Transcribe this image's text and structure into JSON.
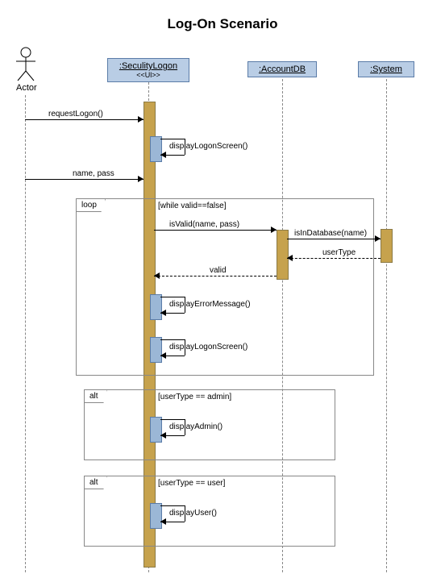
{
  "title": "Log-On Scenario",
  "actor": {
    "label": "Actor"
  },
  "lifelines": {
    "security": {
      "label": ":SeculityLogon",
      "stereotype": "<<Ul>>"
    },
    "accountdb": {
      "label": ":AccountDB"
    },
    "system": {
      "label": ":System"
    }
  },
  "messages": {
    "requestLogon": "requestLogon()",
    "displayLogonScreen1": "displayLogonScreen()",
    "namePass": "name, pass",
    "isValid": "isValid(name, pass)",
    "isInDatabase": "isInDatabase(name)",
    "userType": "userType",
    "valid": "valid",
    "displayErrorMessage": "displayErrorMessage()",
    "displayLogonScreen2": "displayLogonScreen()",
    "displayAdmin": "displayAdmin()",
    "displayUser": "displayUser()"
  },
  "frames": {
    "loop": {
      "operator": "loop",
      "guard": "[while valid==false]"
    },
    "alt1": {
      "operator": "alt",
      "guard": "[userType == admin]"
    },
    "alt2": {
      "operator": "alt",
      "guard": "[userType == user]"
    }
  },
  "chart_data": {
    "type": "uml-sequence-diagram",
    "title": "Log-On Scenario",
    "participants": [
      {
        "id": "actor",
        "name": "Actor",
        "kind": "actor"
      },
      {
        "id": "security",
        "name": ":SeculityLogon",
        "stereotype": "<<Ul>>",
        "kind": "object"
      },
      {
        "id": "accountdb",
        "name": ":AccountDB",
        "kind": "object"
      },
      {
        "id": "system",
        "name": ":System",
        "kind": "object"
      }
    ],
    "messages": [
      {
        "from": "actor",
        "to": "security",
        "label": "requestLogon()",
        "type": "sync"
      },
      {
        "from": "security",
        "to": "security",
        "label": "displayLogonScreen()",
        "type": "self"
      },
      {
        "from": "actor",
        "to": "security",
        "label": "name, pass",
        "type": "sync"
      },
      {
        "fragment": "loop",
        "guard": "[while valid==false]",
        "contains": [
          {
            "from": "security",
            "to": "accountdb",
            "label": "isValid(name, pass)",
            "type": "sync"
          },
          {
            "from": "accountdb",
            "to": "system",
            "label": "isInDatabase(name)",
            "type": "sync"
          },
          {
            "from": "system",
            "to": "accountdb",
            "label": "userType",
            "type": "return"
          },
          {
            "from": "accountdb",
            "to": "security",
            "label": "valid",
            "type": "return"
          },
          {
            "from": "security",
            "to": "security",
            "label": "displayErrorMessage()",
            "type": "self"
          },
          {
            "from": "security",
            "to": "security",
            "label": "displayLogonScreen()",
            "type": "self"
          }
        ]
      },
      {
        "fragment": "alt",
        "guard": "[userType == admin]",
        "contains": [
          {
            "from": "security",
            "to": "security",
            "label": "displayAdmin()",
            "type": "self"
          }
        ]
      },
      {
        "fragment": "alt",
        "guard": "[userType == user]",
        "contains": [
          {
            "from": "security",
            "to": "security",
            "label": "displayUser()",
            "type": "self"
          }
        ]
      }
    ]
  }
}
